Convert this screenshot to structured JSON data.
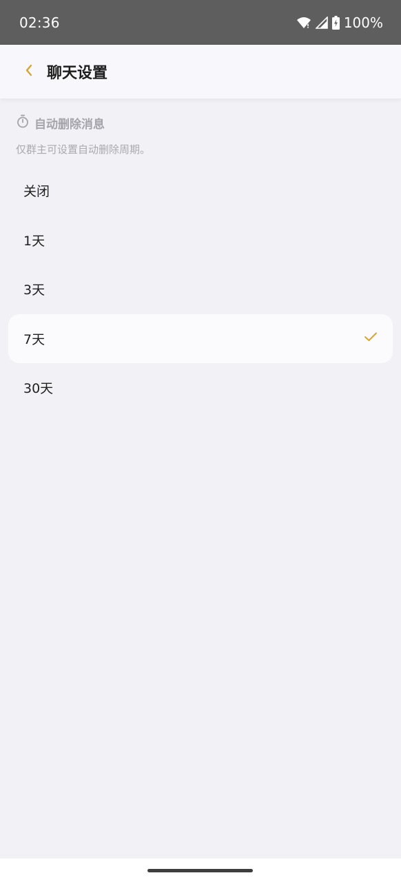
{
  "status_bar": {
    "time": "02:36",
    "battery": "100%",
    "icons": [
      "wifi-icon",
      "signal-icon",
      "battery-charging-icon"
    ]
  },
  "header": {
    "back_icon": "chevron-left-icon",
    "title": "聊天设置"
  },
  "section": {
    "icon": "timer-icon",
    "title": "自动删除消息",
    "description": "仅群主可设置自动删除周期。"
  },
  "options": [
    {
      "label": "关闭",
      "selected": false
    },
    {
      "label": "1天",
      "selected": false
    },
    {
      "label": "3天",
      "selected": false
    },
    {
      "label": "7天",
      "selected": true
    },
    {
      "label": "30天",
      "selected": false
    }
  ],
  "colors": {
    "accent": "#d4a437",
    "background": "#f1f1f6",
    "status_bar": "#5e5e5e",
    "header_bg": "#f8f8fc",
    "selected_bg": "#fbfbfd",
    "muted_text": "#a4a4aa"
  }
}
